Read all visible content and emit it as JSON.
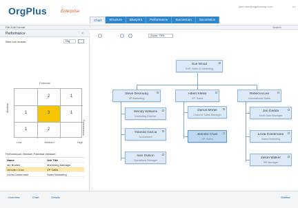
{
  "app": {
    "name": "OrgPlus",
    "edition": "Enterprise",
    "user_email": "jane.doe@orgpluscorp.com",
    "user_extra": "Lo"
  },
  "tabs": [
    {
      "label": "Chart",
      "active": true
    },
    {
      "label": "Structure",
      "active": false
    },
    {
      "label": "Blueprint",
      "active": false
    },
    {
      "label": "Performance",
      "active": false
    },
    {
      "label": "Succession",
      "active": false
    },
    {
      "label": "Succession",
      "active": false
    }
  ],
  "toolbar": {
    "menu_text": "File  Edit  Format",
    "search_label": "Search"
  },
  "left_panel": {
    "title": "Performance",
    "view_label": "Nine box mosaic",
    "view_value": "Rtg",
    "filter_text": "Performance: Medium  Potential: Medium",
    "matrix": {
      "top_label": "Potential",
      "left_label": "Medium",
      "right_label": "Performance",
      "bottom_labels": [
        "Low",
        "Medium",
        "High"
      ],
      "numbers": [
        {
          "row": 0,
          "col": 0,
          "value": ""
        },
        {
          "row": 0,
          "col": 1,
          "value": "2"
        },
        {
          "row": 0,
          "col": 2,
          "value": "1"
        },
        {
          "row": 1,
          "col": 0,
          "value": "1"
        },
        {
          "row": 1,
          "col": 1,
          "value": "3"
        },
        {
          "row": 1,
          "col": 2,
          "value": "1"
        },
        {
          "row": 2,
          "col": 0,
          "value": "1"
        },
        {
          "row": 2,
          "col": 1,
          "value": "2"
        },
        {
          "row": 2,
          "col": 2,
          "value": ""
        }
      ]
    },
    "table": {
      "headers": [
        "Name",
        "Job Title"
      ],
      "rows": [
        [
          "Ian Budish",
          "Marketing Manager"
        ],
        [
          "Jennifer Chan",
          "VP Sales"
        ],
        [
          "Linda Colebrooke",
          "Sales Marketing"
        ]
      ],
      "selected_row": 1
    }
  },
  "canvas": {
    "zoom_text": "Zoom: 75%"
  },
  "nodes": [
    {
      "id": "root",
      "name": "Sue Wood",
      "title": "SVP, Sales & Marketing",
      "highlight": false
    },
    {
      "id": "l1",
      "name": "Steve Decloung",
      "title": "VP Marketing",
      "highlight": false
    },
    {
      "id": "l2",
      "name": "Albert Kleiss",
      "title": "VP, Sales",
      "highlight": false
    },
    {
      "id": "l3",
      "name": "Rebecca Lee",
      "title": "International Sales",
      "highlight": false
    },
    {
      "id": "m1",
      "name": "Wendy Williams",
      "title": "Marketing Director",
      "highlight": false
    },
    {
      "id": "m2",
      "name": "Yolanda Garcia",
      "title": "Accountant",
      "highlight": false
    },
    {
      "id": "m3",
      "name": "Ivan Dulson",
      "title": "Operations Manager",
      "highlight": false
    },
    {
      "id": "c1",
      "name": "Darius Monte",
      "title": "Channel Sales Manager",
      "highlight": false
    },
    {
      "id": "c2",
      "name": "Jennifer Chan",
      "title": "VP, Sales",
      "highlight": true
    },
    {
      "id": "r1",
      "name": "Jan Gadda",
      "title": "North Asia Manager",
      "highlight": false
    },
    {
      "id": "r2",
      "name": "Linda Colebrooke",
      "title": "Sales Marketing",
      "highlight": false
    },
    {
      "id": "r3",
      "name": "Jason Walker",
      "title": "HR Manager",
      "highlight": false
    }
  ],
  "bottom": {
    "links": [
      "Overview",
      "Chart",
      "Details"
    ],
    "right_link": "Sidebar"
  }
}
